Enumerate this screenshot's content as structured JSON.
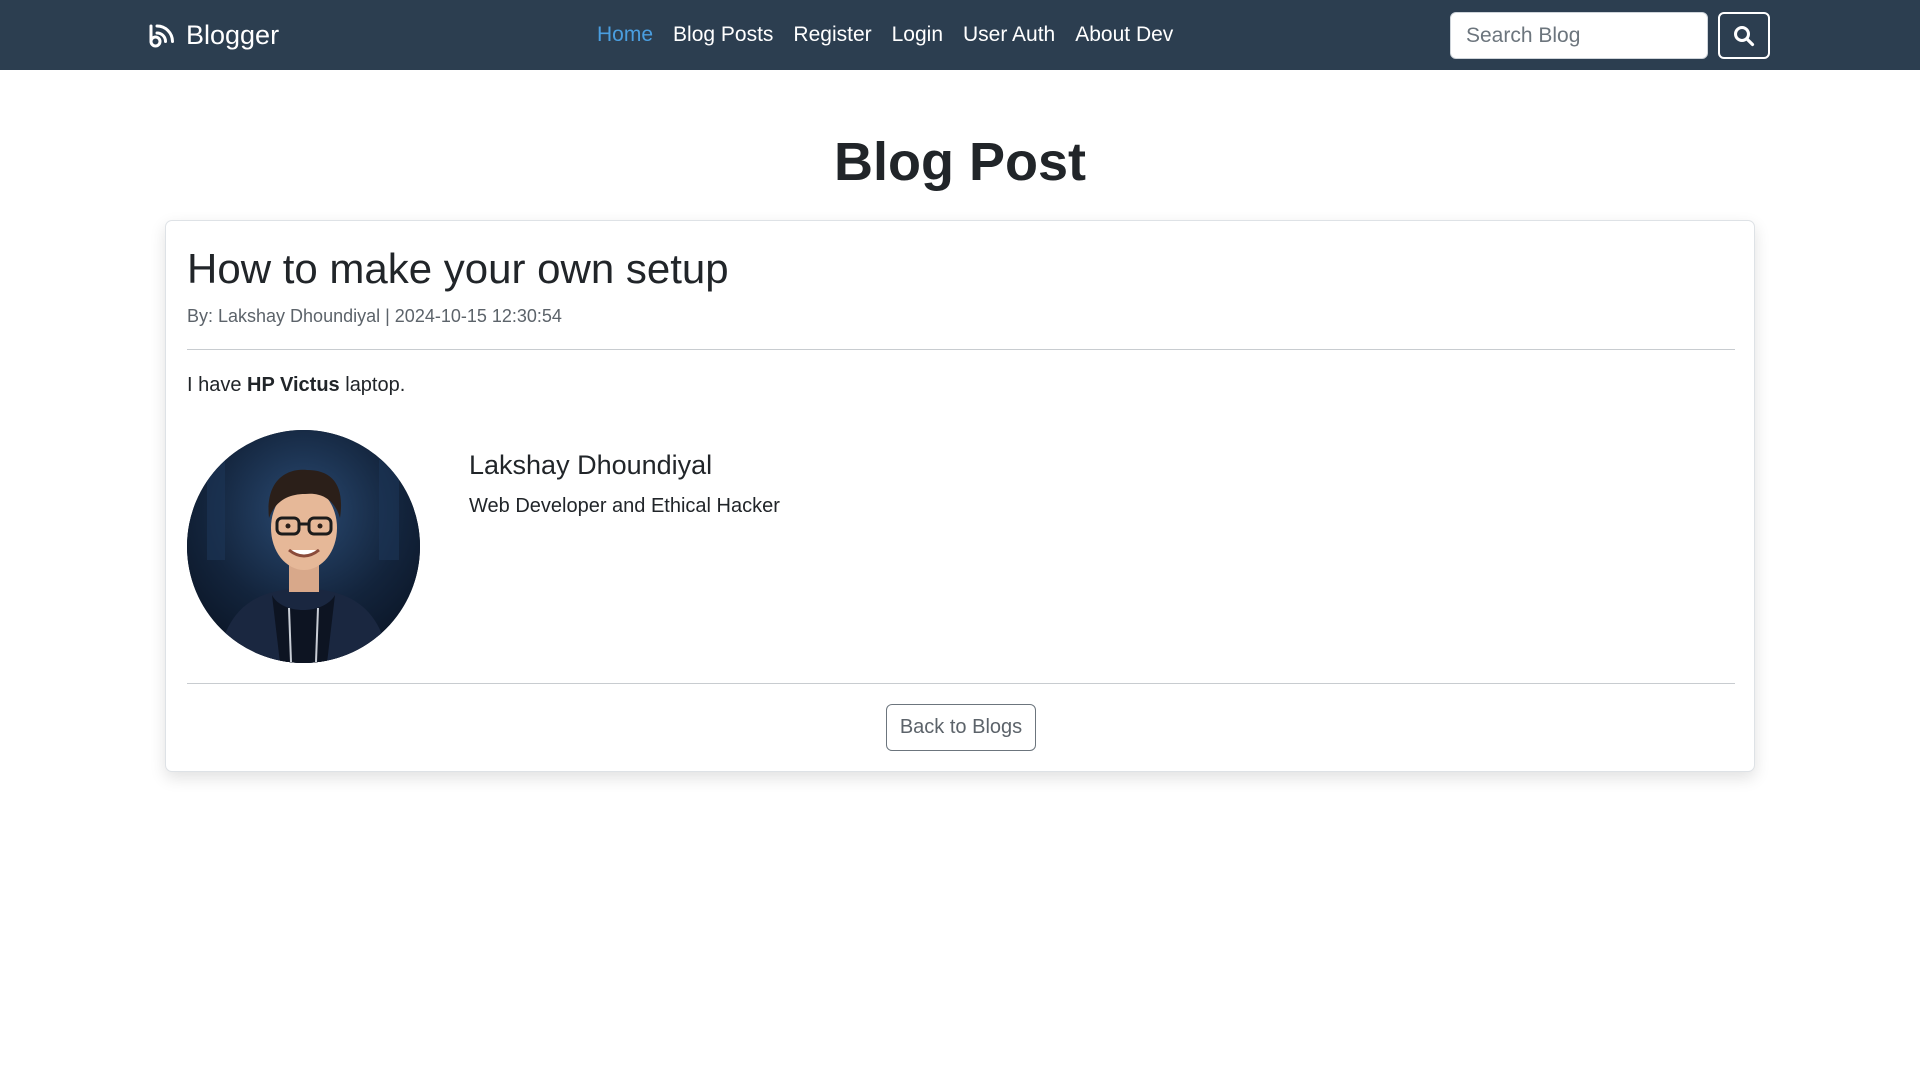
{
  "colors": {
    "navbar_bg": "#2c3e50",
    "active_link": "#4a9ee0"
  },
  "brand": {
    "name": "Blogger",
    "icon": "blog-icon"
  },
  "nav": {
    "items": [
      {
        "label": "Home",
        "active": true
      },
      {
        "label": "Blog Posts",
        "active": false
      },
      {
        "label": "Register",
        "active": false
      },
      {
        "label": "Login",
        "active": false
      },
      {
        "label": "User Auth",
        "active": false
      },
      {
        "label": "About Dev",
        "active": false
      }
    ]
  },
  "search": {
    "placeholder": "Search Blog",
    "value": "",
    "button_icon": "search-icon"
  },
  "page": {
    "title": "Blog Post"
  },
  "post": {
    "title": "How to make your own setup",
    "meta": "By: Lakshay Dhoundiyal | 2024-10-15 12:30:54",
    "body_prefix": "I have ",
    "body_bold": "HP Victus",
    "body_suffix": " laptop."
  },
  "author": {
    "name": "Lakshay Dhoundiyal",
    "role": "Web Developer and Ethical Hacker"
  },
  "actions": {
    "back_label": "Back to Blogs"
  }
}
